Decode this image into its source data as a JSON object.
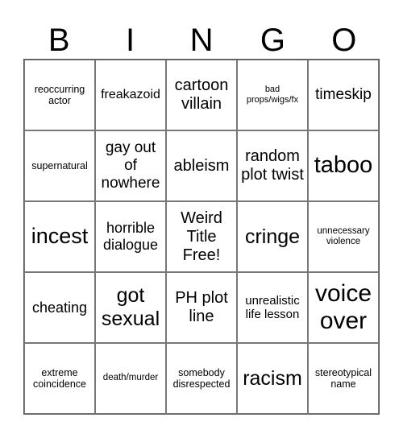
{
  "header": [
    "B",
    "I",
    "N",
    "G",
    "O"
  ],
  "cells": [
    "reoccurring actor",
    "freakazoid",
    "cartoon villain",
    "bad props/wigs/fx",
    "timeskip",
    "supernatural",
    "gay out of nowhere",
    "ableism",
    "random plot twist",
    "taboo",
    "incest",
    "horrible dialogue",
    "Weird Title Free!",
    "cringe",
    "unnecessary violence",
    "cheating",
    "got sexual",
    "PH plot line",
    "unrealistic life lesson",
    "voice over",
    "extreme coincidence",
    "death/murder",
    "somebody disrespected",
    "racism",
    "stereotypical name"
  ]
}
